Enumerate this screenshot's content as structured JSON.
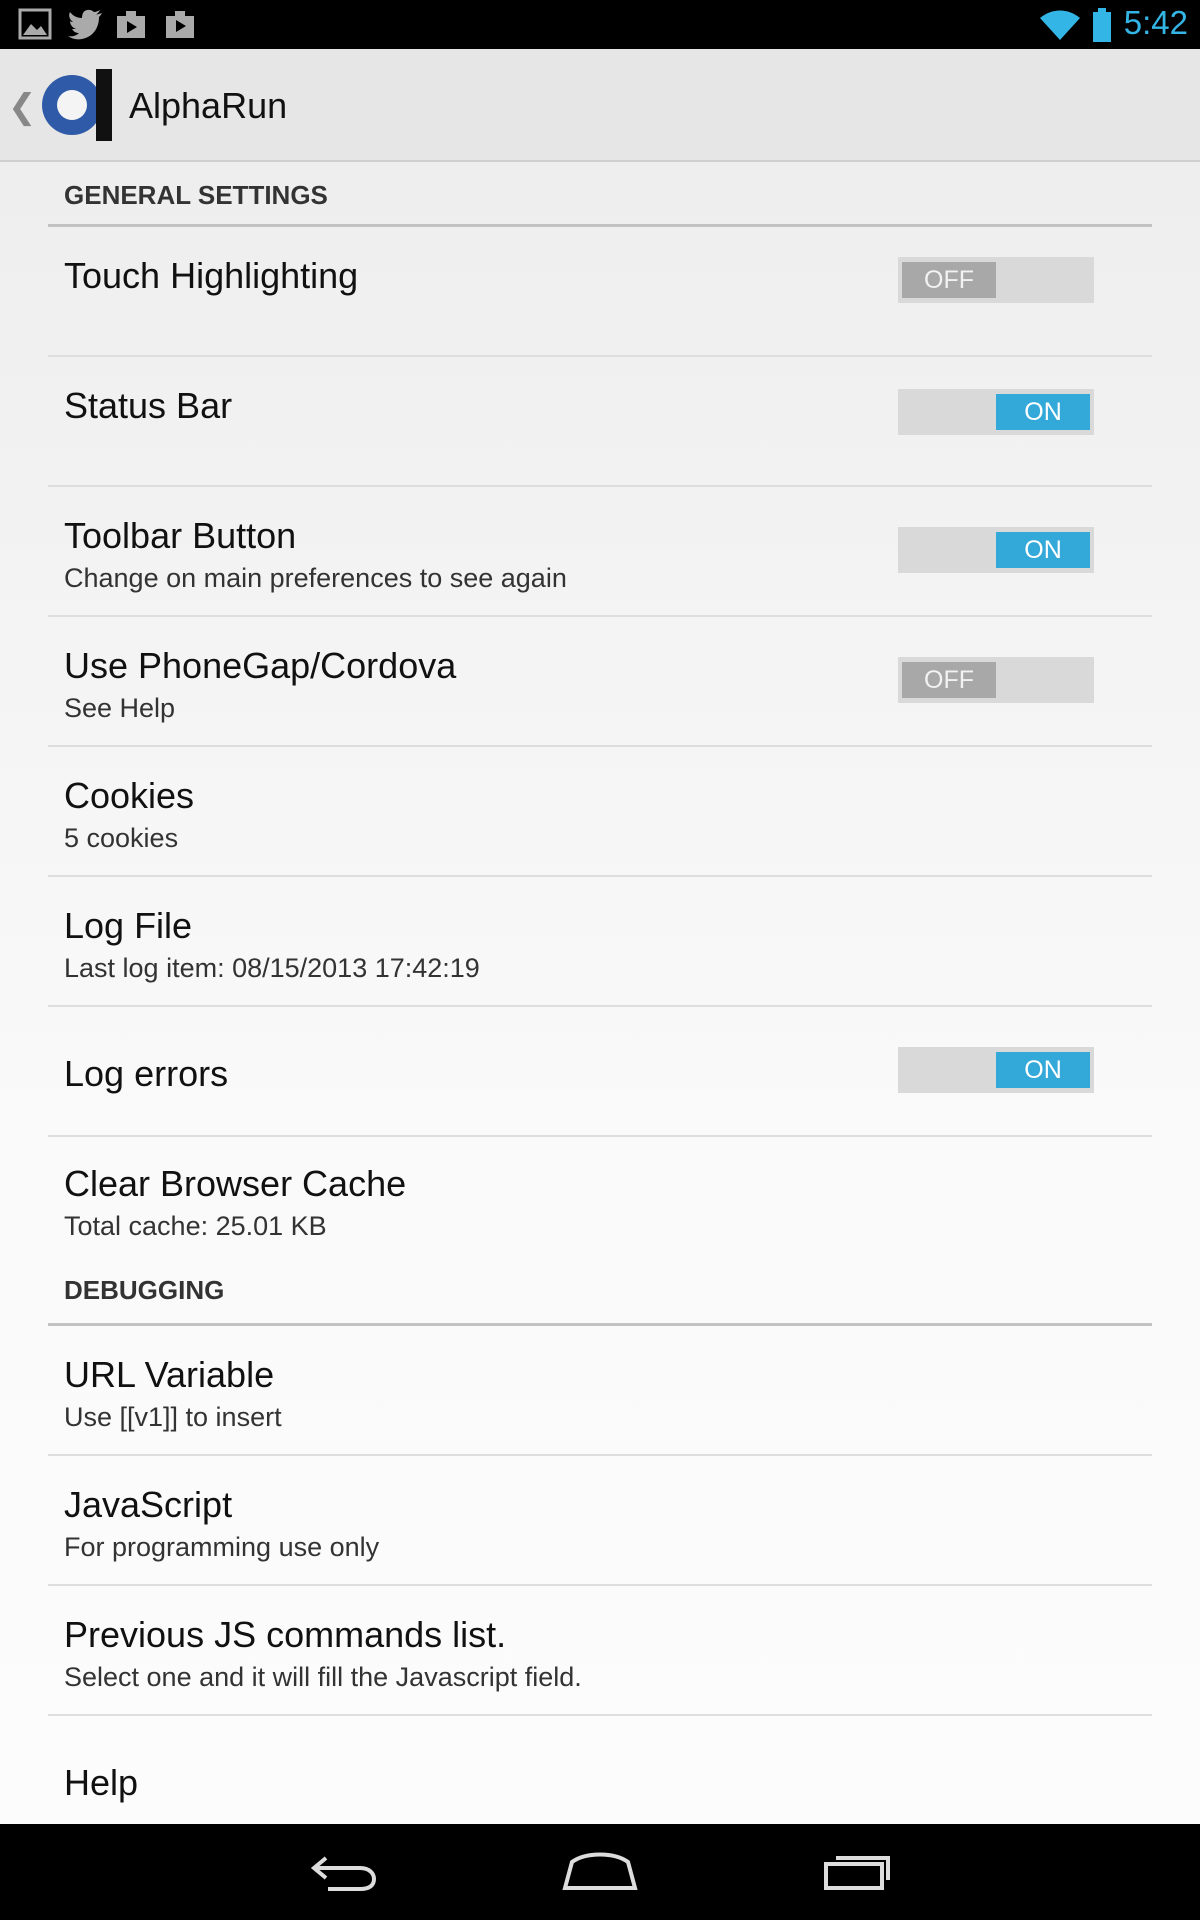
{
  "status_bar": {
    "time": "5:42",
    "left_icons": [
      "gallery-icon",
      "twitter-icon",
      "play-store-icon",
      "shopping-bag-icon"
    ],
    "right_icons": [
      "wifi-icon",
      "battery-icon"
    ],
    "accent_color": "#33b5e5"
  },
  "action_bar": {
    "title": "AlphaRun",
    "logo_color": "#2f5aa8"
  },
  "sections": {
    "general": {
      "header": "GENERAL SETTINGS",
      "touch_highlighting": {
        "title": "Touch Highlighting",
        "state": "OFF"
      },
      "status_bar": {
        "title": "Status Bar",
        "state": "ON"
      },
      "toolbar_button": {
        "title": "Toolbar Button",
        "summary": "Change on main preferences to see again",
        "state": "ON"
      },
      "phonegap": {
        "title": "Use PhoneGap/Cordova",
        "summary": "See Help",
        "state": "OFF"
      },
      "cookies": {
        "title": "Cookies",
        "summary": "5 cookies"
      },
      "log_file": {
        "title": "Log File",
        "summary": "Last log item: 08/15/2013 17:42:19"
      },
      "log_errors": {
        "title": "Log errors",
        "state": "ON"
      },
      "clear_cache": {
        "title": "Clear Browser Cache",
        "summary": "Total cache: 25.01 KB"
      }
    },
    "debugging": {
      "header": "DEBUGGING",
      "url_variable": {
        "title": "URL Variable",
        "summary": "Use [[v1]] to insert"
      },
      "javascript": {
        "title": "JavaScript",
        "summary": "For programming use only"
      },
      "previous_js": {
        "title": "Previous JS commands list.",
        "summary": "Select one and it will fill the Javascript field."
      },
      "help": {
        "title": "Help"
      }
    }
  },
  "nav_bar": {
    "buttons": [
      "back-icon",
      "home-icon",
      "recents-icon"
    ]
  }
}
